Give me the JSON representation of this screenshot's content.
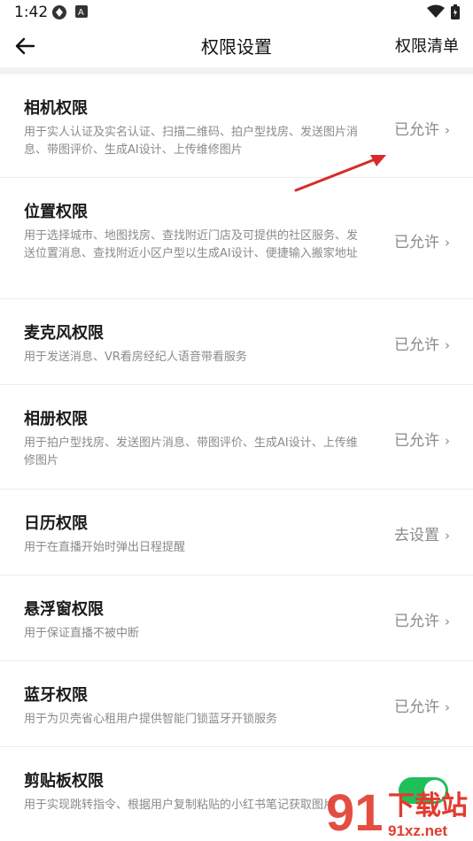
{
  "status_bar": {
    "time": "1:42"
  },
  "header": {
    "title": "权限设置",
    "right_label": "权限清单"
  },
  "permissions": [
    {
      "title": "相机权限",
      "desc": "用于实人认证及实名认证、扫描二维码、拍户型找房、发送图片消息、带图评价、生成AI设计、上传维修图片",
      "status": "已允许"
    },
    {
      "title": "位置权限",
      "desc": "用于选择城市、地图找房、查找附近门店及可提供的社区服务、发送位置消息、查找附近小区户型以生成AI设计、便捷输入搬家地址",
      "status": "已允许"
    },
    {
      "title": "麦克风权限",
      "desc": "用于发送消息、VR看房经纪人语音带看服务",
      "status": "已允许"
    },
    {
      "title": "相册权限",
      "desc": "用于拍户型找房、发送图片消息、带图评价、生成AI设计、上传维修图片",
      "status": "已允许"
    },
    {
      "title": "日历权限",
      "desc": "用于在直播开始时弹出日程提醒",
      "status": "去设置"
    },
    {
      "title": "悬浮窗权限",
      "desc": "用于保证直播不被中断",
      "status": "已允许"
    },
    {
      "title": "蓝牙权限",
      "desc": "用于为贝壳省心租用户提供智能门锁蓝牙开锁服务",
      "status": "已允许"
    },
    {
      "title": "剪贴板权限",
      "desc": "用于实现跳转指令、根据用户复制粘贴的小红书笔记获取图片",
      "status": ""
    }
  ],
  "icons": {
    "back": "arrow-left-icon",
    "chevron": "chevron-right-icon"
  },
  "colors": {
    "accent_toggle": "#1fbf5a",
    "arrow": "#d92a2a",
    "watermark_red": "#e23b2e"
  },
  "watermark": {
    "brand": "下载站",
    "url": "91xz.net",
    "num": "91"
  }
}
